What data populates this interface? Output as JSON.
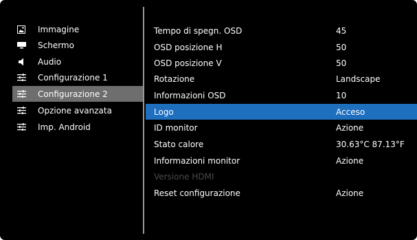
{
  "sidebar": {
    "items": [
      {
        "label": "Immagine",
        "icon": "image-icon"
      },
      {
        "label": "Schermo",
        "icon": "monitor-icon"
      },
      {
        "label": "Audio",
        "icon": "speaker-icon"
      },
      {
        "label": "Configurazione 1",
        "icon": "sliders-icon"
      },
      {
        "label": "Configurazione 2",
        "icon": "sliders-icon",
        "selected": true
      },
      {
        "label": "Opzione avanzata",
        "icon": "sliders-icon"
      },
      {
        "label": "Imp. Android",
        "icon": "sliders-icon"
      }
    ]
  },
  "settings": {
    "rows": [
      {
        "label": "Tempo di spegn. OSD",
        "value": "45"
      },
      {
        "label": "OSD posizione H",
        "value": "50"
      },
      {
        "label": "OSD posizione V",
        "value": "50"
      },
      {
        "label": "Rotazione",
        "value": "Landscape"
      },
      {
        "label": "Informazioni OSD",
        "value": "10"
      },
      {
        "label": "Logo",
        "value": "Acceso",
        "selected": true
      },
      {
        "label": "ID monitor",
        "value": "Azione"
      },
      {
        "label": "Stato calore",
        "value": "30.63°C 87.13°F"
      },
      {
        "label": "Informazioni monitor",
        "value": "Azione"
      },
      {
        "label": "Versione HDMI",
        "value": "",
        "disabled": true
      },
      {
        "label": "Reset configurazione",
        "value": "Azione"
      }
    ]
  },
  "colors": {
    "background": "#000000",
    "selected_row": "#1f6fbf",
    "selected_sidebar": "#6e6e6e",
    "divider": "#9a9a9a",
    "disabled_text": "#4a4a4a"
  }
}
